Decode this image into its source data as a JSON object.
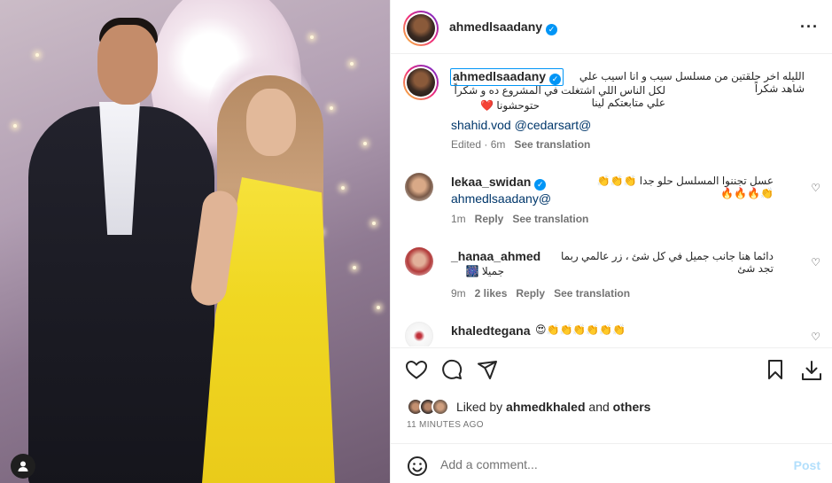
{
  "post": {
    "author": "ahmedlsaadany",
    "verified": true,
    "more_icon": "more-dots-icon"
  },
  "caption": {
    "user": "ahmedlsaadany",
    "line1": "الليله اخر حلقتين من مسلسل سيب و انا اسيب علي شاهد شكراً",
    "line2": "لكل الناس اللي اشتغلت في المشروع ده و شكراً علي متابعتكم لينا",
    "line3": "حتوحشونا ❤️",
    "tags": "shahid.vod @cedarsart@",
    "edited": "Edited · 6m",
    "see_translation": "See translation"
  },
  "comments": [
    {
      "user": "lekaa_swidan",
      "verified": true,
      "text": "عسل تجننوا المسلسل حلو جدا 👏👏👏👏🔥🔥🔥",
      "mention": "ahmedlsaadany@",
      "time": "1m",
      "reply": "Reply",
      "see_translation": "See translation"
    },
    {
      "user": "_hanaa_ahmed",
      "text": "دائما هنا جانب جميل في كل شئ ، زر عالمي ربما تجد شئ",
      "text2": "جميلا 🎆",
      "time": "9m",
      "likes": "2 likes",
      "reply": "Reply",
      "see_translation": "See translation"
    },
    {
      "user": "khaledtegana",
      "text": "😍👏👏👏👏👏👏"
    }
  ],
  "liked_by": {
    "prefix": "Liked by",
    "user": "ahmedkhaled",
    "and": "and",
    "others": "others"
  },
  "timestamp": "11 MINUTES AGO",
  "add_comment": {
    "placeholder": "Add a comment...",
    "post_label": "Post"
  }
}
